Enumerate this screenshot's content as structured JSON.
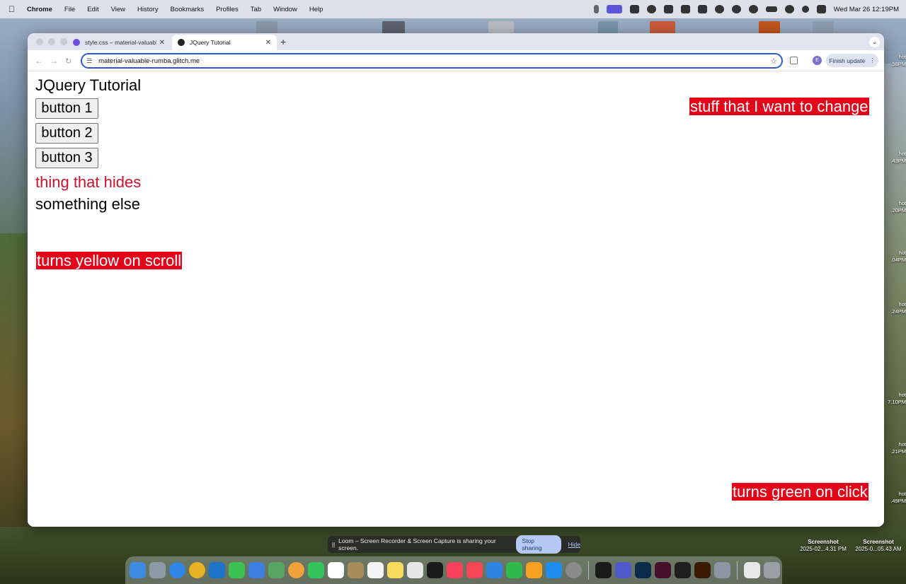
{
  "menubar": {
    "app": "Chrome",
    "items": [
      "File",
      "Edit",
      "View",
      "History",
      "Bookmarks",
      "Profiles",
      "Tab",
      "Window",
      "Help"
    ],
    "clock": "Wed Mar 26  12:19PM"
  },
  "browser": {
    "tabs": [
      {
        "title": "style.css – material-valuable",
        "favicon_color": "#6e4bd9"
      },
      {
        "title": "JQuery Tutorial",
        "favicon_color": "#222222"
      }
    ],
    "new_tab": "+",
    "tab_close": "✕",
    "url": "material-valuable-rumba.glitch.me",
    "profile_initial": "E",
    "finish_update": "Finish update"
  },
  "page": {
    "title": "JQuery Tutorial",
    "buttons": [
      "button 1",
      "button 2",
      "button 3"
    ],
    "hides_text": "thing that hides",
    "something_else": "something else",
    "change_text": "stuff that I want to change",
    "scroll_text": "turns yellow on scroll",
    "click_text": "turns green on click",
    "accent_red": "#e3061b"
  },
  "loom": {
    "message": "Loom – Screen Recorder & Screen Capture is sharing your screen.",
    "stop": "Stop sharing",
    "hide": "Hide"
  },
  "desktop": {
    "labels": [
      {
        "name": "Screenshot",
        "date": "2025-02...4.31 PM"
      },
      {
        "name": "Screenshot",
        "date": "2025-0...05.43 AM"
      }
    ],
    "side_labels": [
      "hot",
      ".58PM",
      "hot",
      ".43PM",
      "hot",
      ".20PM",
      "hot",
      ".04PM",
      "hot",
      ".24PM",
      "hot",
      "7.10PM",
      "hot",
      ".21PM",
      "hot",
      ".49PM"
    ]
  }
}
